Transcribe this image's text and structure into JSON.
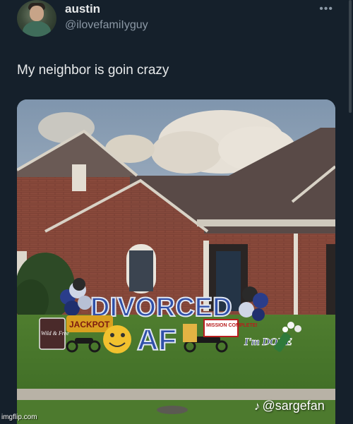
{
  "tweet": {
    "display_name": "austin",
    "handle": "@ilovefamiIyguy",
    "more_icon": "more-horizontal-icon",
    "text": "My neighbor is goin crazy"
  },
  "photo": {
    "sign_main": "DIVORCED",
    "sign_af": "AF",
    "sign_jackpot": "JACKPOT",
    "sign_wild": "Wild & Free",
    "sign_mission": "MISSION COMPLETE!",
    "sign_done": "I'm DONE"
  },
  "watermark": {
    "icon": "tiktok-icon",
    "text": "@sargefan"
  },
  "credit": "imgflip.com",
  "colors": {
    "background": "#15202b",
    "text_primary": "#e7e9ea",
    "text_secondary": "#8b98a5",
    "sign_blue": "#2f4fa8"
  }
}
